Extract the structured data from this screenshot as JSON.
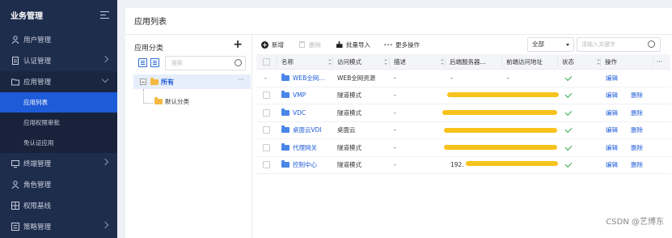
{
  "sidebar": {
    "title": "业务管理",
    "items": [
      {
        "label": "用户管理"
      },
      {
        "label": "认证管理"
      },
      {
        "label": "应用管理"
      },
      {
        "label": "终端管理"
      },
      {
        "label": "角色管理"
      },
      {
        "label": "权限基线"
      },
      {
        "label": "策略管理"
      }
    ],
    "sub_items": [
      {
        "label": "应用列表"
      },
      {
        "label": "应用权限审批"
      },
      {
        "label": "免认证应用"
      }
    ]
  },
  "page_title": "应用列表",
  "tree": {
    "title": "应用分类",
    "add_label": "+",
    "search_placeholder": "搜索",
    "root_label": "所有",
    "root_more": "···",
    "child_label": "默认分类"
  },
  "toolbar": {
    "add_label": "新增",
    "delete_label": "删除",
    "import_label": "批量导入",
    "more_label": "更多操作",
    "filter_value": "全部",
    "search_placeholder": "请输入关键字"
  },
  "table": {
    "columns": [
      "名称",
      "访问模式",
      "描述",
      "后端服务器...",
      "前端访问地址",
      "状态",
      "操作"
    ],
    "more_icon": "···",
    "rows": [
      {
        "name": "WEB全网...",
        "mode": "WEB全网资源",
        "desc": "-",
        "backend": "-",
        "frontend": "-",
        "status": "ok",
        "actions": [
          "编辑"
        ],
        "checkbox": "-"
      },
      {
        "name": "VMP",
        "mode": "隧道模式",
        "desc": "-",
        "backend": "",
        "frontend": "",
        "status": "ok",
        "actions": [
          "编辑",
          "删除"
        ]
      },
      {
        "name": "VDC",
        "mode": "隧道模式",
        "desc": "-",
        "backend": "",
        "frontend": "",
        "status": "ok",
        "actions": [
          "编辑",
          "删除"
        ]
      },
      {
        "name": "桌面云VDI",
        "mode": "桌面云",
        "desc": "-",
        "backend": "",
        "frontend": "",
        "status": "ok",
        "actions": [
          "编辑",
          "删除"
        ]
      },
      {
        "name": "代理网关",
        "mode": "隧道模式",
        "desc": "-",
        "backend": "",
        "frontend": "",
        "status": "ok",
        "actions": [
          "编辑",
          "删除"
        ]
      },
      {
        "name": "控制中心",
        "mode": "隧道模式",
        "desc": "-",
        "backend": "192.",
        "frontend": "",
        "status": "ok",
        "actions": [
          "编辑",
          "删除"
        ]
      }
    ]
  },
  "watermark": "CSDN @艺博东",
  "colors": {
    "sidebar_bg": "#1f2d4d",
    "accent": "#1e5bd8",
    "success": "#27a844",
    "redaction": "#f8c21c",
    "folder": "#f5b942"
  }
}
